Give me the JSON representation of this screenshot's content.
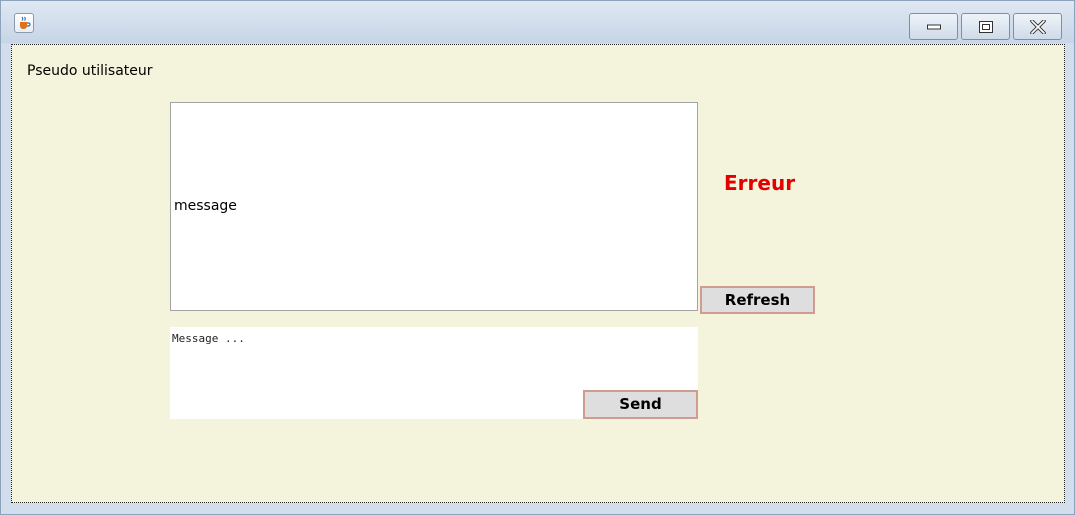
{
  "window": {
    "app_icon": "java-cup-icon",
    "controls": [
      "minimize-icon",
      "maximize-icon",
      "close-icon"
    ]
  },
  "content": {
    "user_label": "Pseudo utilisateur",
    "message_area_text": "message",
    "error_text": "Erreur",
    "refresh_label": "Refresh",
    "input_text": "Message ...",
    "send_label": "Send"
  },
  "colors": {
    "panel_background": "#f4f3db",
    "error_color": "#e20000",
    "button_border": "#d09c90",
    "button_background": "#dedede"
  }
}
